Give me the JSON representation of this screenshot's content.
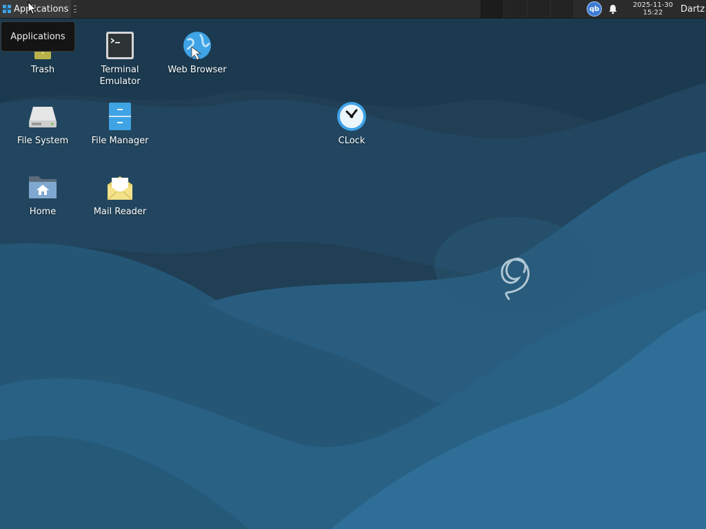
{
  "panel": {
    "applications_label": "Applications",
    "clock_date": "2025-11-30",
    "clock_time": "15:22",
    "user_label": "Dartz",
    "tray_qb_label": "qb",
    "icons": {
      "apps_logo": "applications-menu-icon",
      "tray": "qbittorrent-icon",
      "notifications": "bell-icon"
    }
  },
  "tooltip": {
    "text": "Applications"
  },
  "desktop": {
    "icons": [
      {
        "name": "trash",
        "label": "Trash",
        "icon": "trash-icon"
      },
      {
        "name": "terminal",
        "label": "Terminal\nEmulator",
        "icon": "terminal-icon"
      },
      {
        "name": "web-browser",
        "label": "Web Browser",
        "icon": "globe-icon"
      },
      {
        "name": "file-system",
        "label": "File System",
        "icon": "hard-drive-icon"
      },
      {
        "name": "file-manager",
        "label": "File Manager",
        "icon": "file-cabinet-icon"
      },
      {
        "name": "clock",
        "label": "CLock",
        "icon": "clock-icon"
      },
      {
        "name": "home",
        "label": "Home",
        "icon": "home-folder-icon"
      },
      {
        "name": "mail-reader",
        "label": "Mail Reader",
        "icon": "envelope-icon"
      }
    ]
  },
  "colors": {
    "wallpaper_dark": "#1f4158",
    "wallpaper_mid": "#24506e",
    "wallpaper_light": "#2d6a91",
    "panel": "#2b2b2b",
    "accent_blue": "#3fa3e6"
  }
}
